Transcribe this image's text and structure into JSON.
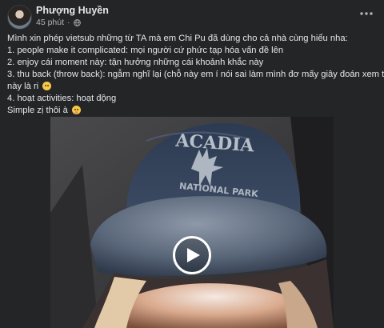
{
  "post": {
    "author": "Phượng Huyền",
    "timestamp": "45 phút",
    "audience_icon": "globe-icon",
    "more_icon": "more-horizontal-icon",
    "lines": [
      "Mình xin phép vietsub những từ TA mà em Chi Pu đã dùng cho cả nhà cùng hiểu nha:",
      "1. people make it complicated: mọi người cứ phức tạp hóa vấn đề lên",
      "2. enjoy cái moment này: tận hưởng những cái khoảnh khắc này",
      "3. thu back (throw back): ngẫm nghĩ lại (chỗ này em í nói sai làm mình đơ mấy giây đoán xem từ",
      "này là ri",
      "4. hoạt activities: hoạt động",
      "Simple zị thôi à"
    ],
    "emoji_line_5": "grinning-sweat-emoji",
    "emoji_line_7": "blushing-emoji"
  },
  "video": {
    "cap_text_front": "ACADIA",
    "cap_text_lower": "NATIONAL PARK",
    "play_icon": "play-icon",
    "colors": {
      "cap": "#2f3e55",
      "background": "#3b3b3d"
    }
  }
}
